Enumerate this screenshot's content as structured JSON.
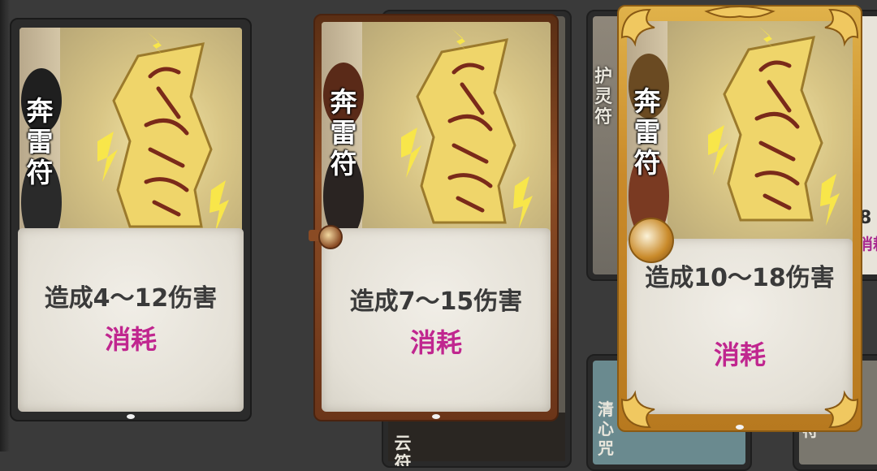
{
  "cards": [
    {
      "title": "奔雷符",
      "effect": "造成4～12伤害",
      "tag": "消耗",
      "state": "normal"
    },
    {
      "title": "奔雷符",
      "effect": "造成7～15伤害",
      "tag": "消耗",
      "state": "bronze"
    },
    {
      "title": "奔雷符",
      "effect": "造成10～18伤害",
      "tag": "消耗",
      "state": "gold"
    }
  ],
  "background_cards": {
    "hu_ling_fu": "护灵符",
    "yun_partial": "云符",
    "qing_xin_partial": "清心咒",
    "qi_partial": "气符",
    "partial_number": "8",
    "partial_tag": "消耗"
  },
  "colors": {
    "consume_pink": "#c0268f",
    "bronze_frame": "#8a4b24",
    "gold_frame": "#c98a2a",
    "dark_frame": "#2b2b2b"
  }
}
